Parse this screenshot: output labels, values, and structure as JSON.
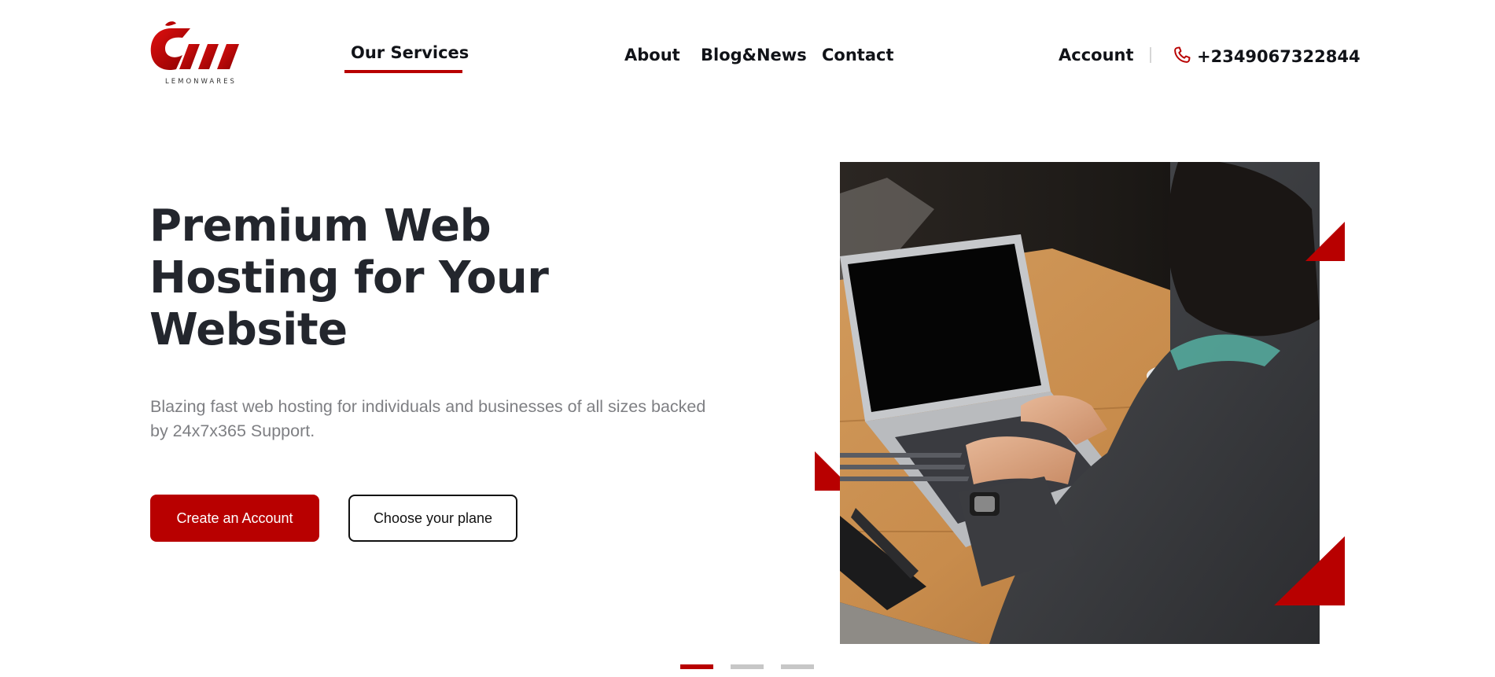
{
  "brand": {
    "logo_text": "LEMONWARES"
  },
  "nav": {
    "services": "Our Services",
    "about": "About",
    "blog": "Blog&News",
    "contact": "Contact",
    "account": "Account",
    "phone": "+2349067322844",
    "phone_icon": "phone-icon"
  },
  "hero": {
    "title": "Premium Web Hosting for Your Website",
    "subtitle": "Blazing fast web hosting for individuals and businesses of all sizes backed by 24x7x365 Support.",
    "primary_button": "Create an Account",
    "secondary_button": "Choose your plane"
  },
  "slider": {
    "total": 3,
    "active": 1
  },
  "colors": {
    "accent": "#b80000",
    "heading": "#23262d",
    "muted": "#7e7f83",
    "indicator": "#c7c7c7"
  }
}
